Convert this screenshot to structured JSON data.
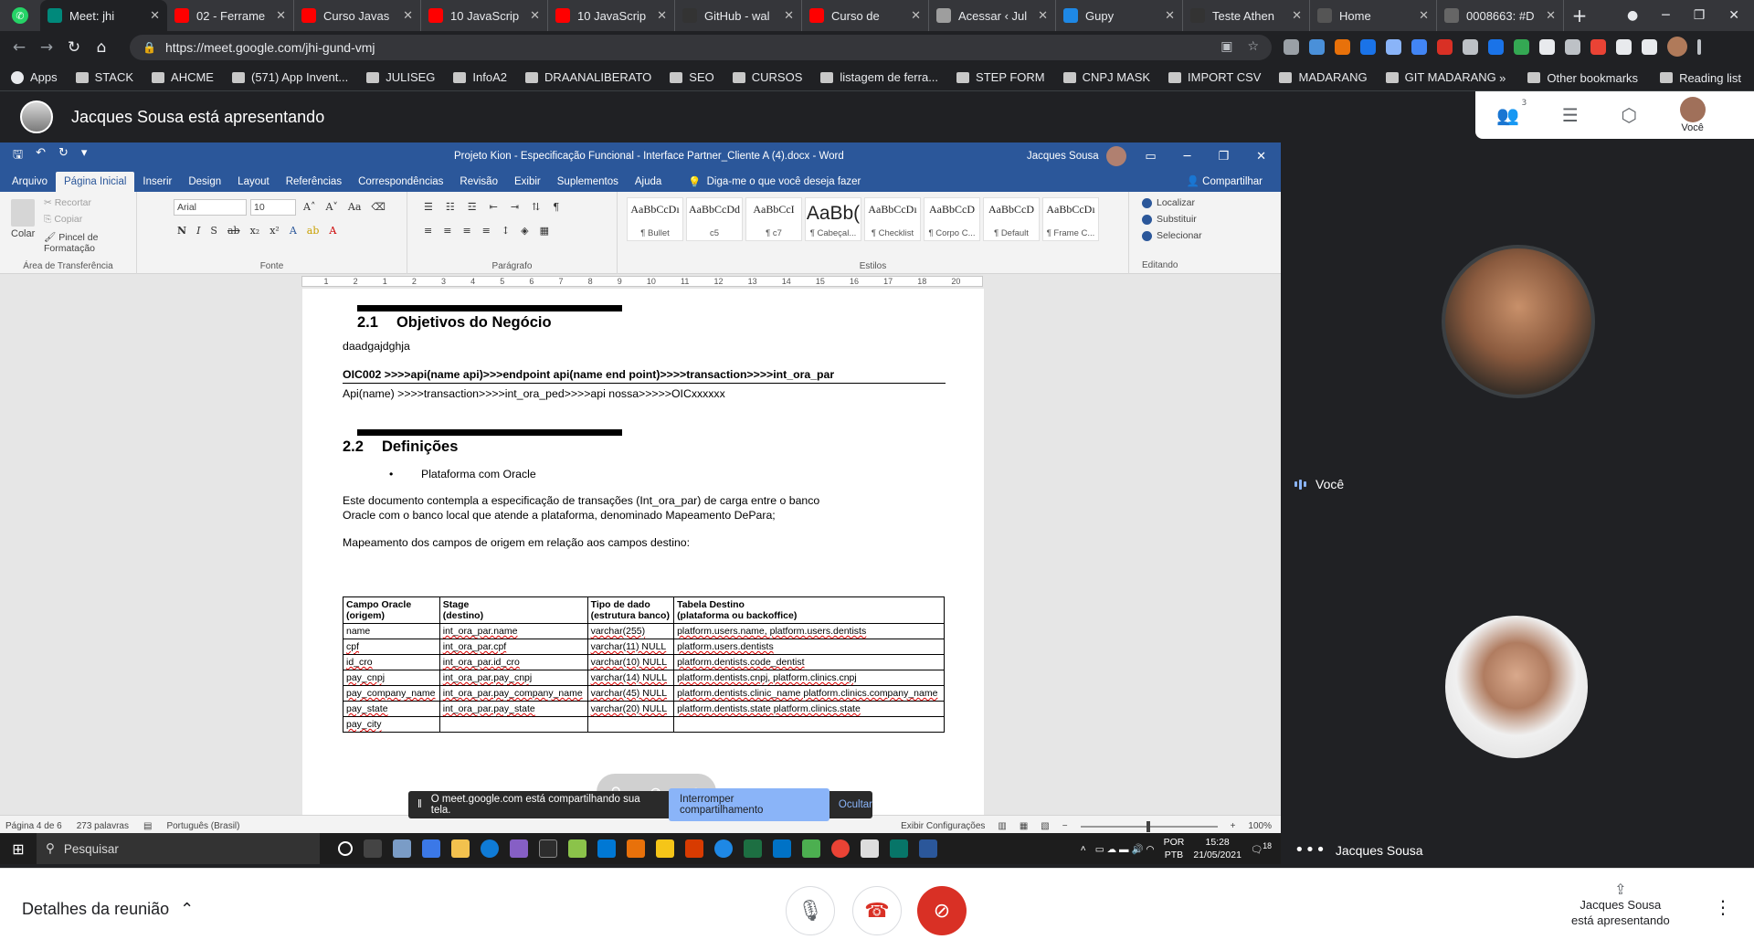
{
  "browser": {
    "tabs": [
      {
        "title": "Meet: jhi",
        "color": "#00897b"
      },
      {
        "title": "02 - Ferrame",
        "color": "#ff0000"
      },
      {
        "title": "Curso Javas",
        "color": "#ff0000"
      },
      {
        "title": "10 JavaScrip",
        "color": "#ff0000"
      },
      {
        "title": "10 JavaScrip",
        "color": "#ff0000"
      },
      {
        "title": "GitHub - wal",
        "color": "#333333"
      },
      {
        "title": "Curso de",
        "color": "#ff0000"
      },
      {
        "title": "Acessar ‹ Jul",
        "color": "#9e9e9e"
      },
      {
        "title": "Gupy",
        "color": "#1e88e5"
      },
      {
        "title": "Teste Athen",
        "color": "#333333"
      },
      {
        "title": "Home",
        "color": "#555555"
      },
      {
        "title": "0008663: #D",
        "color": "#666666"
      }
    ],
    "url": "https://meet.google.com/jhi-gund-vmj",
    "bookmarks": [
      "Apps",
      "STACK",
      "AHCME",
      "(571) App Invent...",
      "JULISEG",
      "InfoA2",
      "DRAANALIBERATO",
      "SEO",
      "CURSOS",
      "listagem de ferra...",
      "STEP FORM",
      "CNPJ MASK",
      "IMPORT CSV",
      "MADARANG",
      "GIT MADARANG"
    ],
    "bookmarks_right": [
      "Other bookmarks",
      "Reading list"
    ]
  },
  "meet": {
    "presenter_banner": "Jacques Sousa está apresentando",
    "participants_count": "3",
    "you_label": "Você",
    "tiles": {
      "you": "Você",
      "other": "Jacques Sousa"
    },
    "details": "Detalhes da reunião",
    "presenting_line1": "Jacques Sousa",
    "presenting_line2": "está apresentando"
  },
  "word": {
    "doc_title": "Projeto Kion - Especificação Funcional - Interface Partner_Cliente A (4).docx - Word",
    "user": "Jacques Sousa",
    "tabs": [
      "Arquivo",
      "Página Inicial",
      "Inserir",
      "Design",
      "Layout",
      "Referências",
      "Correspondências",
      "Revisão",
      "Exibir",
      "Suplementos",
      "Ajuda"
    ],
    "tell_me": "Diga-me o que você deseja fazer",
    "share": "Compartilhar",
    "clipboard": {
      "paste": "Colar",
      "cut": "Recortar",
      "copy": "Copiar",
      "format_painter": "Pincel de Formatação",
      "label": "Área de Transferência"
    },
    "font": {
      "name": "Arial",
      "size": "10",
      "label": "Fonte"
    },
    "paragraph_label": "Parágrafo",
    "styles": [
      {
        "preview": "AaBbCcDı",
        "name": "¶ Bullet"
      },
      {
        "preview": "AaBbCcDd",
        "name": "c5"
      },
      {
        "preview": "AaBbCcI",
        "name": "¶ c7"
      },
      {
        "preview": "AaBb(",
        "name": "¶ Cabeçal..."
      },
      {
        "preview": "AaBbCcDı",
        "name": "¶ Checklist"
      },
      {
        "preview": "AaBbCcD",
        "name": "¶ Corpo C..."
      },
      {
        "preview": "AaBbCcD",
        "name": "¶ Default"
      },
      {
        "preview": "AaBbCcDı",
        "name": "¶ Frame C..."
      }
    ],
    "styles_label": "Estilos",
    "editing": {
      "find": "Localizar",
      "replace": "Substituir",
      "select": "Selecionar",
      "label": "Editando"
    },
    "ruler_ticks": [
      "1",
      "2",
      "1",
      "2",
      "3",
      "4",
      "5",
      "6",
      "7",
      "8",
      "9",
      "10",
      "11",
      "12",
      "13",
      "14",
      "15",
      "16",
      "17",
      "18",
      "20"
    ],
    "document": {
      "h21_num": "2.1",
      "h21_title": "Objetivos do Negócio",
      "line1": "daadgajdghja",
      "line2": "OIC002 >>>>api(name api)>>>endpoint api(name end point)>>>>transaction>>>>int_ora_par",
      "line3": "Api(name) >>>>transaction>>>>int_ora_ped>>>>api nossa>>>>>OICxxxxxx",
      "h22_num": "2.2",
      "h22_title": "Definições",
      "bullet": "Plataforma com Oracle",
      "para1a": "Este documento contempla a especificação de transações (Int_ora_par) de carga entre o banco",
      "para1b": "Oracle com o banco local que atende a plataforma, denominado Mapeamento DePara;",
      "para2": "Mapeamento dos campos de origem em relação aos campos destino:",
      "table": {
        "headers": [
          [
            "Campo Oracle",
            "(origem)"
          ],
          [
            "Stage",
            "(destino)"
          ],
          [
            "Tipo de dado",
            "(estrutura banco)"
          ],
          [
            "Tabela Destino",
            "(plataforma ou backoffice)"
          ]
        ],
        "rows": [
          [
            "name",
            "int_ora_par.name",
            "varchar(255)",
            "platform.users.name, platform.users.dentists"
          ],
          [
            "cpf",
            "int_ora_par.cpf",
            "varchar(11) NULL",
            "platform.users.dentists"
          ],
          [
            "id_cro",
            "int_ora_par.id_cro",
            "varchar(10) NULL",
            "platform.dentists.code_dentist"
          ],
          [
            "pay_cnpj",
            "int_ora_par.pay_cnpj",
            "varchar(14) NULL",
            "platform.dentists.cnpj, platform.clinics.cnpj"
          ],
          [
            "pay_company_name",
            "int_ora_par.pay_company_name",
            "varchar(45) NULL",
            "platform.dentists.clinic_name platform.clinics.company_name"
          ],
          [
            "pay_state",
            "int_ora_par.pay_state",
            "varchar(20) NULL",
            "platform.dentists.state platform.clinics.state"
          ],
          [
            "pay_city",
            "",
            "",
            ""
          ]
        ]
      }
    },
    "status": {
      "page": "Página 4 de 6",
      "words": "273 palavras",
      "language": "Português (Brasil)",
      "display": "Exibir Configurações",
      "zoom": "100%"
    }
  },
  "share_notice": {
    "text": "O meet.google.com está compartilhando sua tela.",
    "stop": "Interromper compartilhamento",
    "hide": "Ocultar"
  },
  "taskbar": {
    "search": "Pesquisar",
    "lang1": "POR",
    "lang2": "PTB",
    "time": "15:28",
    "date": "21/05/2021",
    "notif": "18"
  }
}
